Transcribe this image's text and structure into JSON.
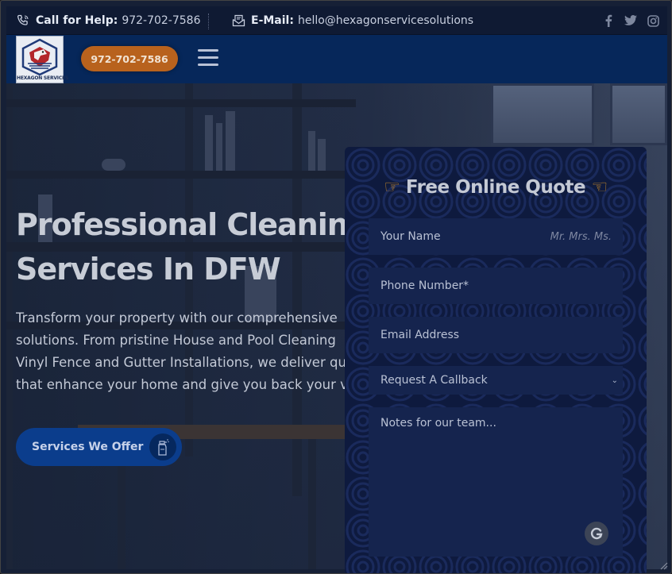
{
  "topbar": {
    "call_label": "Call for Help:",
    "call_number": "972-702-7586",
    "email_label": "E-Mail:",
    "email_value": "hello@hexagonservicesolutions",
    "social": [
      "facebook-icon",
      "twitter-icon",
      "instagram-icon"
    ]
  },
  "nav": {
    "logo_text": "HEXAGON SERVICES",
    "phone_button": "972-702-7586",
    "menu_icon": "hamburger-icon"
  },
  "hero": {
    "title_line1": "Professional Cleanin",
    "title_line2": "Services In DFW",
    "desc_lines": [
      "Transform your property with our comprehensive",
      "solutions. From pristine House and Pool Cleaning",
      "Vinyl Fence and Gutter Installations, we deliver qu",
      "that enhance your home and give you back your v"
    ],
    "cta_label": "Services We Offer",
    "cta_icon": "spray-bottle-icon"
  },
  "quote_form": {
    "title": "Free Online Quote",
    "title_icons": [
      "pointing-hand-right-icon",
      "pointing-hand-left-icon"
    ],
    "name_label": "Your Name",
    "name_hint": "Mr. Mrs. Ms.",
    "phone_placeholder": "Phone Number*",
    "email_placeholder": "Email Address",
    "select_value": "Request A Callback",
    "notes_placeholder": "Notes for our team..."
  },
  "colors": {
    "topbar_bg": "#0f1a33",
    "navbar_bg": "#06275a",
    "phone_pill": "#b8621d",
    "form_bg": "#0e1a3e",
    "field_bg": "#15244e",
    "cta_bg": "#0b3d8c"
  }
}
